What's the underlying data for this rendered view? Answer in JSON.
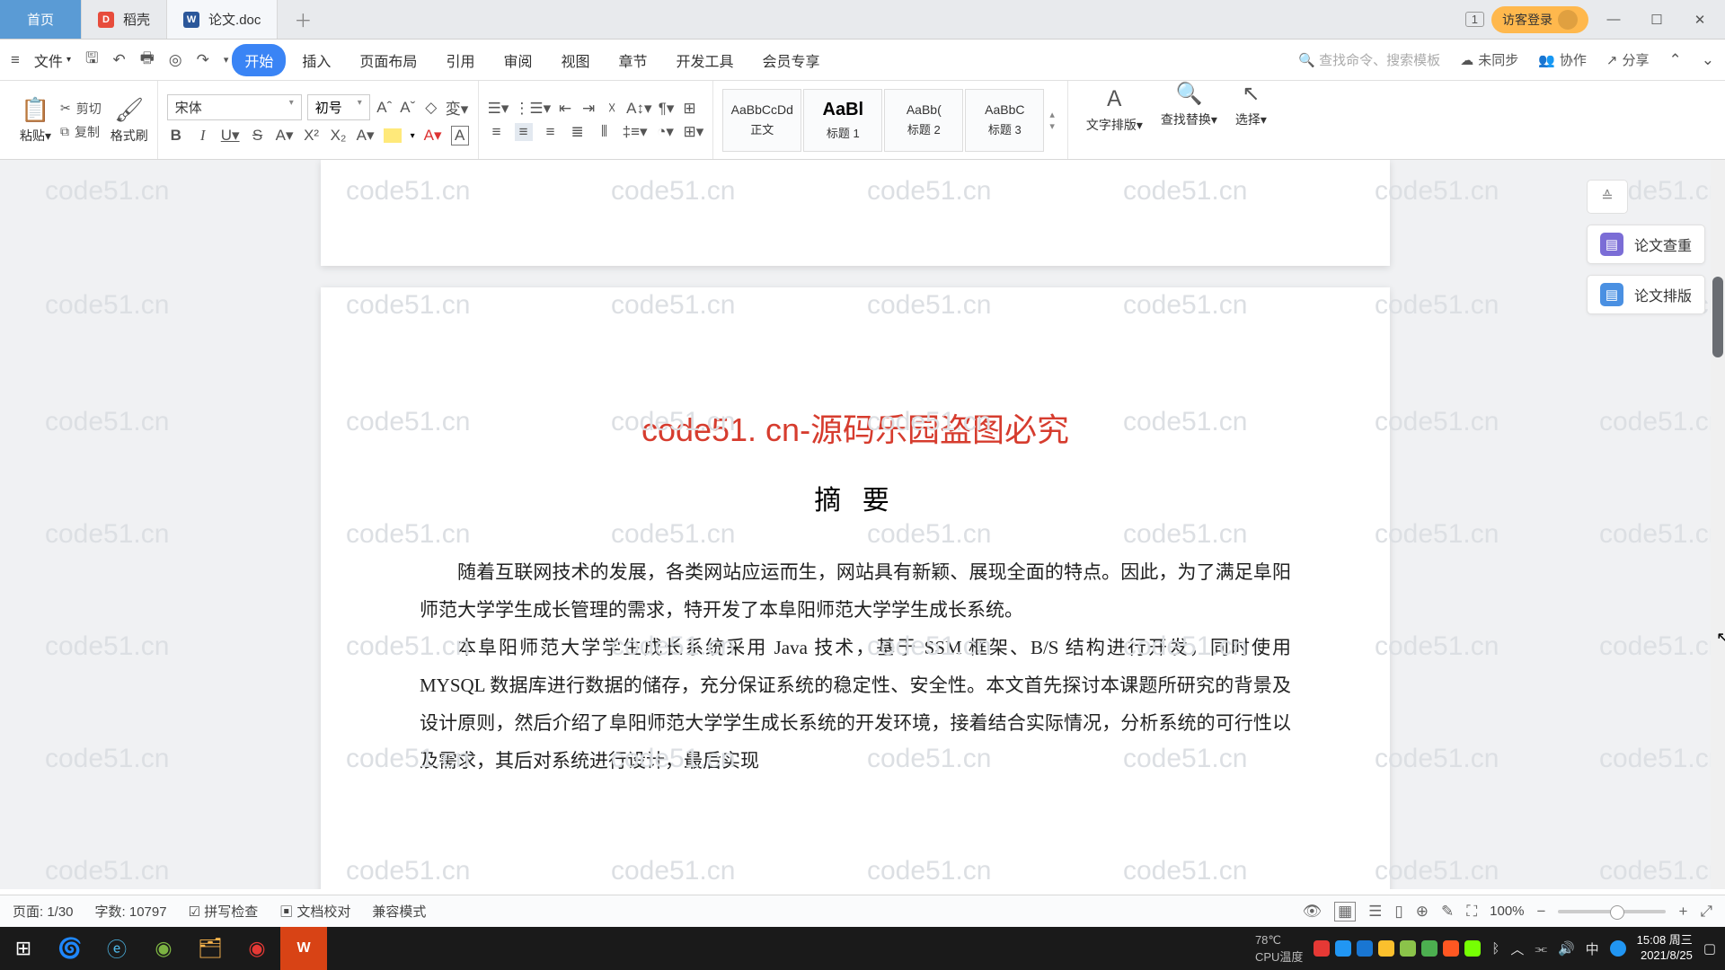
{
  "titlebar": {
    "tabs": {
      "home": "首页",
      "docao": "稻壳",
      "doc": "论文.doc"
    },
    "tabnum": "1",
    "login": "访客登录"
  },
  "menubar": {
    "file": "文件",
    "tabs": {
      "start": "开始",
      "insert": "插入",
      "layout": "页面布局",
      "ref": "引用",
      "review": "审阅",
      "view": "视图",
      "chapter": "章节",
      "dev": "开发工具",
      "vip": "会员专享"
    },
    "search_placeholder": "查找命令、搜索模板",
    "sync": "未同步",
    "collab": "协作",
    "share": "分享"
  },
  "ribbon": {
    "paste": "粘贴",
    "cut": "剪切",
    "copy": "复制",
    "brush": "格式刷",
    "font_name": "宋体",
    "font_size": "初号",
    "styles": {
      "body": "正文",
      "h1": "标题 1",
      "h2": "标题 2",
      "h3": "标题 3"
    },
    "style_prev": {
      "body": "AaBbCcDd",
      "h1": "AaBl",
      "h2": "AaBb(",
      "h3": "AaBbC"
    },
    "textdir": "文字排版",
    "find": "查找替换",
    "select": "选择"
  },
  "sidepanel": {
    "check": "论文查重",
    "format": "论文排版"
  },
  "document": {
    "title": "code51. cn-源码乐园盗图必究",
    "subtitle": "摘  要",
    "p1": "随着互联网技术的发展，各类网站应运而生，网站具有新颖、展现全面的特点。因此，为了满足阜阳师范大学学生成长管理的需求，特开发了本阜阳师范大学学生成长系统。",
    "p2": "本阜阳师范大学学生成长系统采用 Java 技术，基于 SSM 框架、B/S 结构进行开发，同时使用 MYSQL 数据库进行数据的储存，充分保证系统的稳定性、安全性。本文首先探讨本课题所研究的背景及设计原则，然后介绍了阜阳师范大学学生成长系统的开发环境，接着结合实际情况，分析系统的可行性以及需求，其后对系统进行设计，最后实现"
  },
  "watermark": "code51.cn",
  "status": {
    "page": "页面: 1/30",
    "words": "字数: 10797",
    "spell": "拼写检查",
    "proof": "文档校对",
    "compat": "兼容模式",
    "zoom": "100%"
  },
  "taskbar": {
    "cpu": "CPU温度",
    "temp": "78℃",
    "time": "15:08 周三",
    "date": "2021/8/25",
    "ime": "中"
  }
}
